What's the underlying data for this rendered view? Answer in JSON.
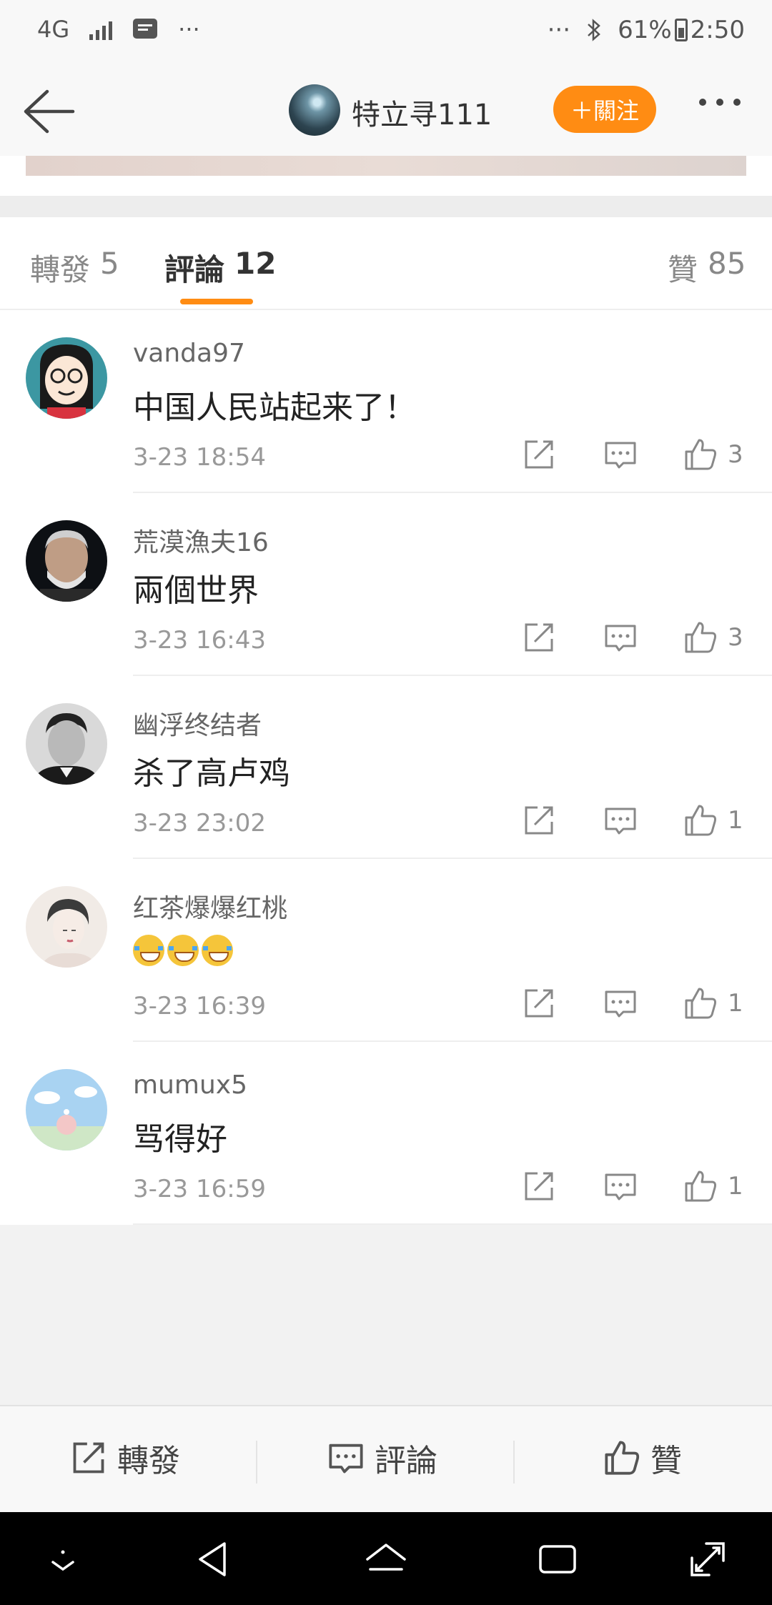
{
  "status_bar": {
    "network": "4G",
    "left_more": "···",
    "right_more": "···",
    "battery": "61%",
    "time": "2:50",
    "icons": [
      "signal-icon",
      "message-icon",
      "bluetooth-icon",
      "battery-icon"
    ]
  },
  "header": {
    "username": "特立寻111",
    "follow_label": "＋關注"
  },
  "tabs": [
    {
      "label": "轉發",
      "count": "5"
    },
    {
      "label": "評論",
      "count": "12"
    },
    {
      "label": "贊",
      "count": "85"
    }
  ],
  "comments": [
    {
      "user": "vanda97",
      "text": "中国人民站起来了！",
      "time": "3-23 18:54",
      "likes": "3"
    },
    {
      "user": "荒漠漁夫16",
      "text": "兩個世界",
      "time": "3-23 16:43",
      "likes": "3"
    },
    {
      "user": "幽浮终结者",
      "text": "杀了高卢鸡",
      "time": "3-23 23:02",
      "likes": "1"
    },
    {
      "user": "红茶爆爆红桃",
      "text": "",
      "emoji_count": 3,
      "emoji": "laugh-cry-emoji",
      "time": "3-23 16:39",
      "likes": "1"
    },
    {
      "user": "mumux5",
      "text": "骂得好",
      "time": "3-23 16:59",
      "likes": "1"
    }
  ],
  "toolbar": {
    "repost_label": "轉發",
    "comment_label": "評論",
    "like_label": "贊"
  },
  "colors": {
    "accent": "#ff8c13",
    "text_primary": "#222222",
    "text_secondary": "#999999"
  }
}
